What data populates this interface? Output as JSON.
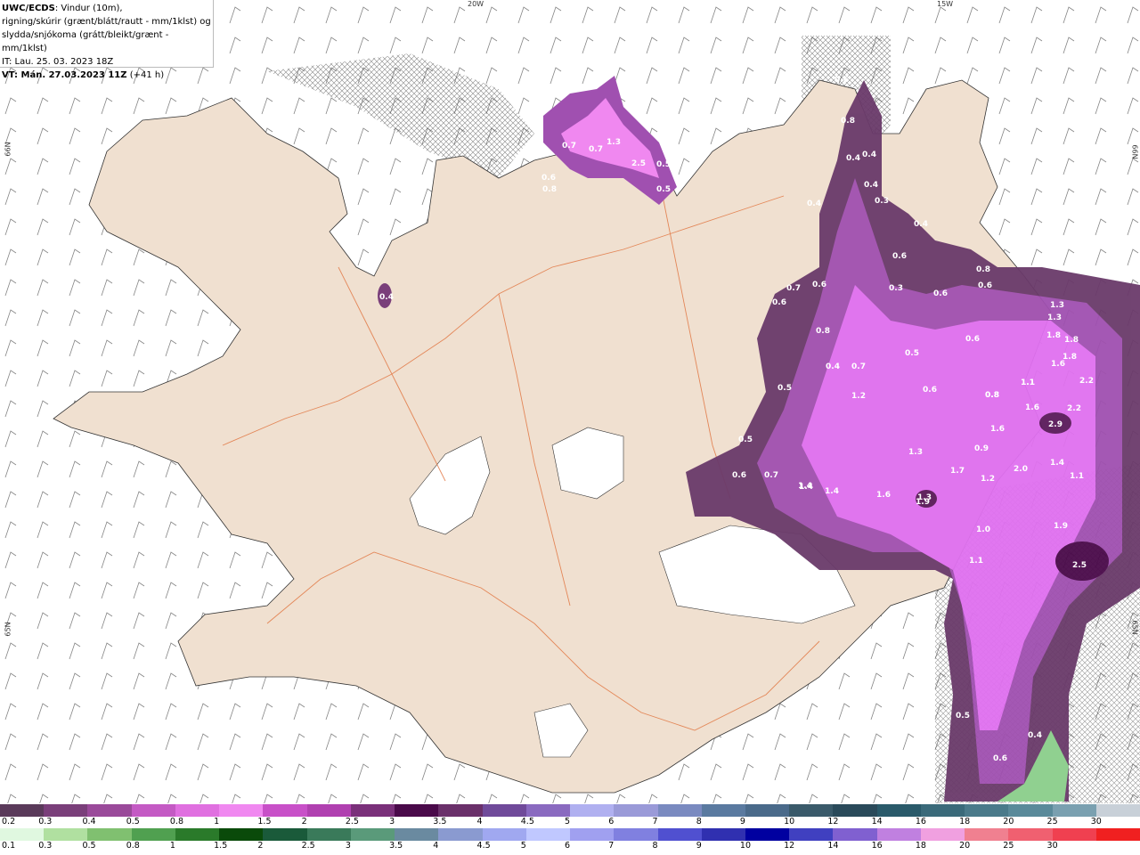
{
  "header": {
    "line1_bold": "UWC/ECDS",
    "line1_rest": ": Vindur (10m),",
    "line2": "rigning/skúrir (grænt/blátt/rautt - mm/1klst) og",
    "line3": "slydda/snjókoma (grátt/bleikt/grænt - mm/1klst)",
    "line4": "IT: Lau. 25. 03. 2023 18Z",
    "line5_bold": "VT: Mán. 27.03.2023 11Z",
    "line5_rest": " (+41 h)"
  },
  "coords": {
    "top_left": "20W",
    "top_right": "15W",
    "left_upper": "66N",
    "left_lower": "65N",
    "right_upper": "66N",
    "right_lower": "65N"
  },
  "legend_snow": {
    "colors": [
      "#5a3a5a",
      "#7a3f7a",
      "#9a4a9a",
      "#c45ac4",
      "#e070e0",
      "#f088f0",
      "#c850c8",
      "#b040b0",
      "#7a307a",
      "#4a0a4a",
      "#6a306a",
      "#704a9a",
      "#8a6ac0",
      "#b0b0f0",
      "#9a9ad8",
      "#7a8ac0",
      "#5a7aa0",
      "#4a6a8a",
      "#3a5a6a",
      "#2a4a5a",
      "#2a5a6a",
      "#3a6a7a",
      "#4a7a8a",
      "#5a8a9a",
      "#7aa0b0",
      "#c8d0d8"
    ],
    "labels": [
      "0.2",
      "0.3",
      "0.4",
      "0.5",
      "0.8",
      "1",
      "1.5",
      "2",
      "2.5",
      "3",
      "3.5",
      "4",
      "4.5",
      "5",
      "6",
      "7",
      "8",
      "9",
      "10",
      "12",
      "14",
      "16",
      "18",
      "20",
      "25",
      "30"
    ]
  },
  "legend_rain": {
    "colors": [
      "#e0f8e0",
      "#b0e0a0",
      "#80c070",
      "#50a050",
      "#2a7a2a",
      "#0a4a0a",
      "#1a5a3a",
      "#3a7a5a",
      "#5a9a7a",
      "#6a8aa0",
      "#8a9ad0",
      "#a0a8f0",
      "#c0c8ff",
      "#a0a0f0",
      "#8080e0",
      "#5050d0",
      "#3030b0",
      "#0000a0",
      "#4040c0",
      "#8060d0",
      "#c080e0",
      "#f0a0e0",
      "#f08090",
      "#f06070",
      "#f04050",
      "#f02020"
    ],
    "labels": [
      "0.1",
      "0.3",
      "0.5",
      "0.8",
      "1",
      "1.5",
      "2",
      "2.5",
      "3",
      "3.5",
      "4",
      "4.5",
      "5",
      "6",
      "7",
      "8",
      "9",
      "10",
      "12",
      "14",
      "16",
      "18",
      "20",
      "25",
      "30"
    ]
  },
  "precip_values": [
    "0.6",
    "0.8",
    "0.4",
    "0.4",
    "0.4",
    "0.3",
    "0.4",
    "0.6",
    "0.3",
    "0.8",
    "0.6",
    "0.4",
    "0.6",
    "0.7",
    "0.6",
    "0.6",
    "0.8",
    "0.5",
    "0.4",
    "0.7",
    "0.6",
    "0.6",
    "0.5",
    "1.3",
    "1.3",
    "1.8",
    "1.8",
    "1.6",
    "1.8",
    "2.2",
    "2.2",
    "2.9",
    "1.6",
    "1.1",
    "1.4",
    "1.1",
    "2.0",
    "1.2",
    "1.7",
    "1.3",
    "1.6",
    "1.9",
    "1.6",
    "1.4",
    "1.4",
    "0.7",
    "0.6",
    "0.5",
    "1.2",
    "0.8",
    "0.9",
    "1.0",
    "1.1",
    "1.9",
    "2.5",
    "0.5",
    "0.4",
    "0.6",
    "0.7",
    "1.3",
    "2.5",
    "0.5",
    "0.5",
    "0.7",
    "1.4",
    "0.4",
    "0.6",
    "0.8",
    "1.3",
    "0.8",
    "1.1"
  ]
}
